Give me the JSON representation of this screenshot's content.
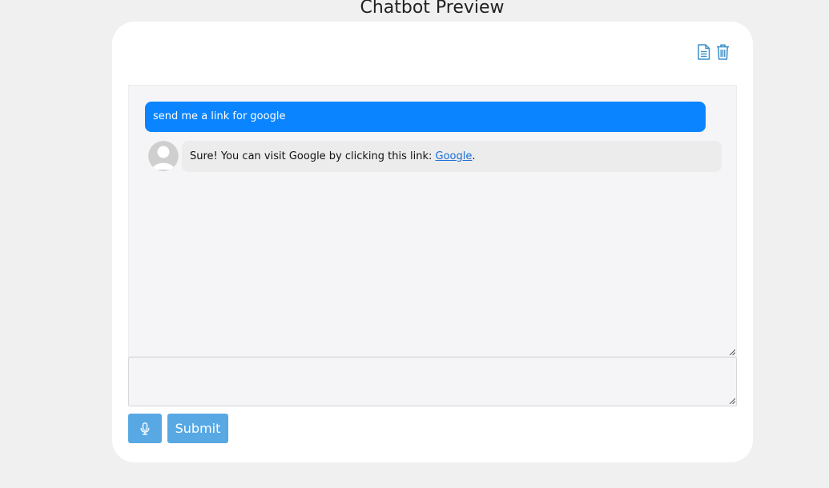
{
  "page": {
    "title": "Chatbot Preview"
  },
  "toolbar": {
    "document_icon": "document-icon",
    "trash_icon": "trash-icon",
    "icon_color": "#3a8fc8"
  },
  "chat": {
    "messages": [
      {
        "role": "user",
        "text": "send me a link for google"
      },
      {
        "role": "bot",
        "text_prefix": "Sure! You can visit Google by clicking this link: ",
        "link_text": "Google",
        "text_suffix": "."
      }
    ],
    "user_bubble_color": "#0a84ff",
    "bot_bubble_color": "#ececec"
  },
  "composer": {
    "input_value": "",
    "mic_icon": "microphone-icon",
    "submit_label": "Submit",
    "button_color": "#57a8e3"
  }
}
